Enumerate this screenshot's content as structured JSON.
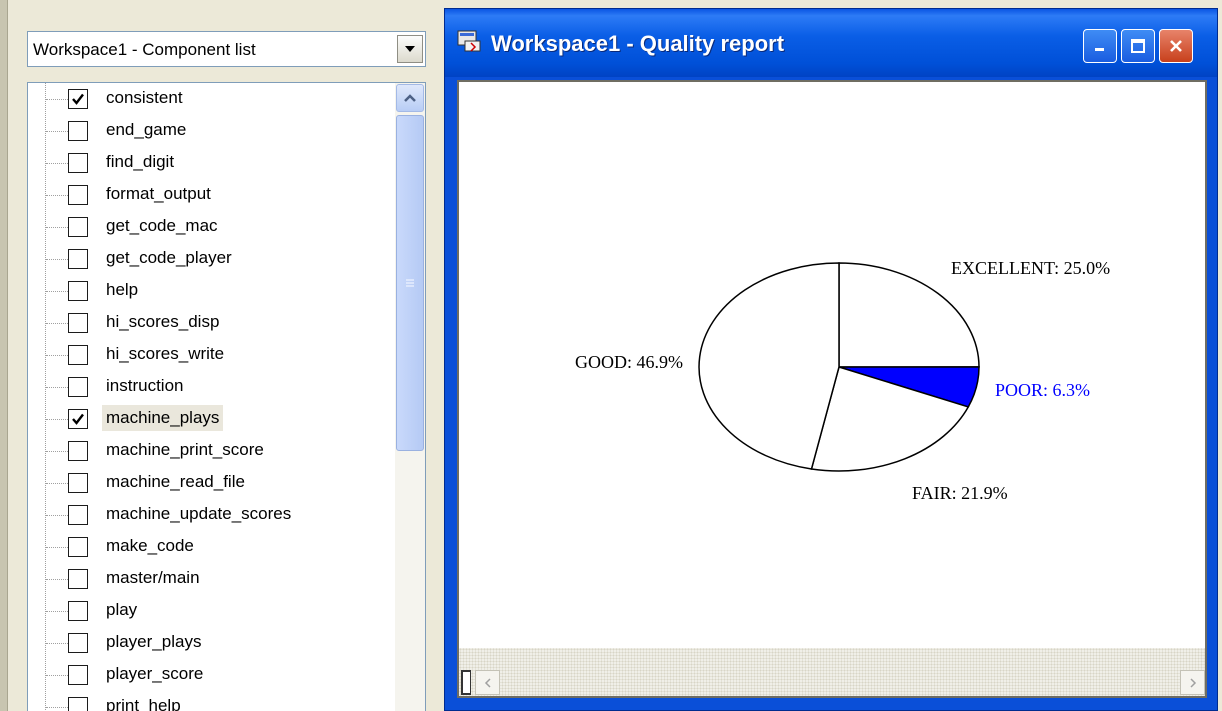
{
  "component_panel": {
    "combo_value": "Workspace1 - Component list",
    "items": [
      {
        "label": "consistent",
        "checked": true
      },
      {
        "label": "end_game",
        "checked": false
      },
      {
        "label": "find_digit",
        "checked": false
      },
      {
        "label": "format_output",
        "checked": false
      },
      {
        "label": "get_code_mac",
        "checked": false
      },
      {
        "label": "get_code_player",
        "checked": false
      },
      {
        "label": "help",
        "checked": false
      },
      {
        "label": "hi_scores_disp",
        "checked": false
      },
      {
        "label": "hi_scores_write",
        "checked": false
      },
      {
        "label": "instruction",
        "checked": false
      },
      {
        "label": "machine_plays",
        "checked": true
      },
      {
        "label": "machine_print_score",
        "checked": false
      },
      {
        "label": "machine_read_file",
        "checked": false
      },
      {
        "label": "machine_update_scores",
        "checked": false
      },
      {
        "label": "make_code",
        "checked": false
      },
      {
        "label": "master/main",
        "checked": false
      },
      {
        "label": "play",
        "checked": false
      },
      {
        "label": "player_plays",
        "checked": false
      },
      {
        "label": "player_score",
        "checked": false
      },
      {
        "label": "print_help",
        "checked": false
      }
    ]
  },
  "report_window": {
    "title": "Workspace1 - Quality report"
  },
  "chart_data": {
    "type": "pie",
    "slices": [
      {
        "label": "EXCELLENT",
        "value": 25.0,
        "display": "EXCELLENT: 25.0%",
        "fill": "#ffffff",
        "label_color": "#000000"
      },
      {
        "label": "POOR",
        "value": 6.3,
        "display": "POOR: 6.3%",
        "fill": "#0000ff",
        "label_color": "#0000ff"
      },
      {
        "label": "FAIR",
        "value": 21.9,
        "display": "FAIR: 21.9%",
        "fill": "#ffffff",
        "label_color": "#000000"
      },
      {
        "label": "GOOD",
        "value": 46.9,
        "display": "GOOD: 46.9%",
        "fill": "#ffffff",
        "label_color": "#000000"
      }
    ]
  }
}
